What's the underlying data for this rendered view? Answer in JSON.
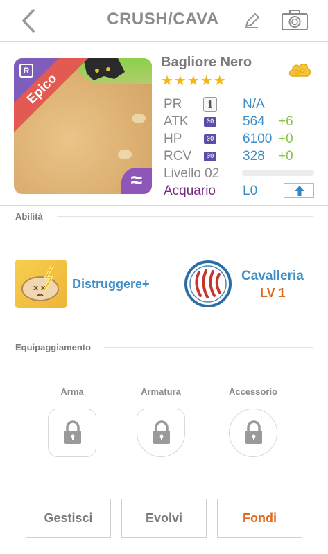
{
  "header": {
    "title": "CRUSH/CAVA"
  },
  "monster": {
    "rarity_badge": "R",
    "rarity_label": "Epico",
    "element_symbol": "≈",
    "name": "Bagliore Nero",
    "stars": "★★★★★",
    "star_count": 5,
    "star_color": "#f1b71a"
  },
  "stats": {
    "pr_label": "PR",
    "pr_value": "N/A",
    "atk_label": "ATK",
    "atk_icon": "00",
    "atk_value": "564",
    "atk_bonus": "+6",
    "hp_label": "HP",
    "hp_icon": "00",
    "hp_value": "6100",
    "hp_bonus": "+0",
    "rcv_label": "RCV",
    "rcv_icon": "00",
    "rcv_value": "328",
    "rcv_bonus": "+0",
    "level_label": "Livello 02",
    "level_progress": 0,
    "element_name": "Acquario",
    "element_level": "L0"
  },
  "abilities": {
    "section_label": "Abilità",
    "skill_name": "Distruggere+",
    "leader_name": "Cavalleria",
    "leader_level": "LV 1"
  },
  "equipment": {
    "section_label": "Equipaggiamento",
    "slots": [
      {
        "label": "Arma"
      },
      {
        "label": "Armatura"
      },
      {
        "label": "Accessorio"
      }
    ]
  },
  "buttons": {
    "manage": "Gestisci",
    "evolve": "Evolvi",
    "fuse": "Fondi",
    "fuse_color": "#e0691a"
  },
  "colors": {
    "accent_blue": "#3e8dc7",
    "bonus_green": "#8bc34a",
    "rarity_red": "#e25a52",
    "element_purple": "#8d56b8"
  },
  "icons": {
    "back": "chevron-left-icon",
    "edit": "pencil-icon",
    "camera": "camera-icon",
    "cloud": "cloud-icon",
    "upgrade": "arrow-up-icon",
    "lock": "lock-icon"
  }
}
